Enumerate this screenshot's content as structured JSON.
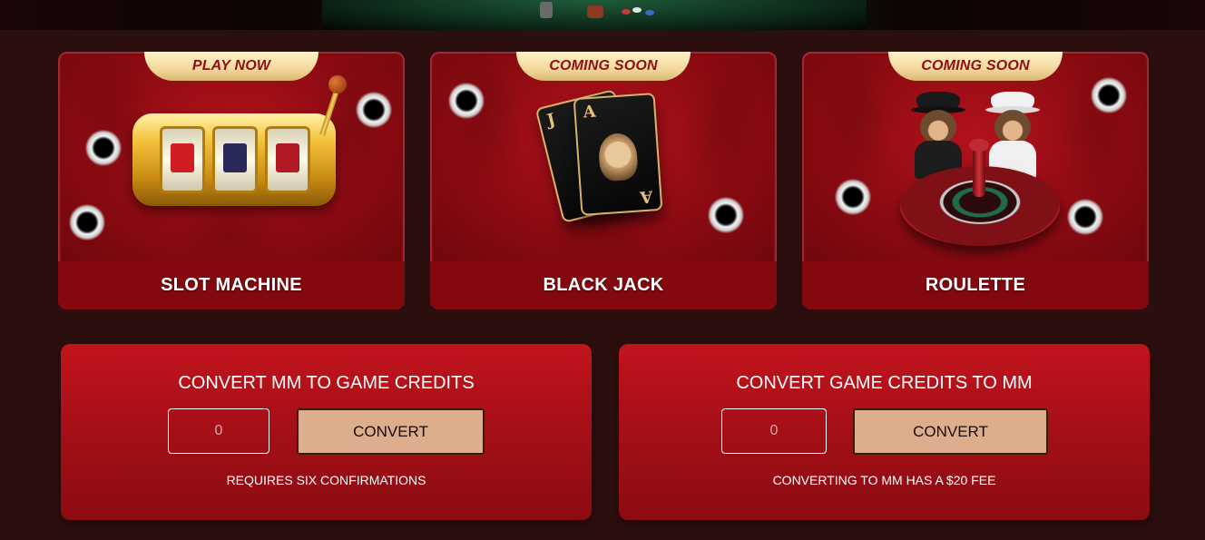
{
  "games": [
    {
      "title": "SLOT MACHINE",
      "status": "PLAY NOW"
    },
    {
      "title": "BLACK JACK",
      "status": "COMING SOON"
    },
    {
      "title": "ROULETTE",
      "status": "COMING SOON"
    }
  ],
  "convert_to_credits": {
    "title": "CONVERT MM TO GAME CREDITS",
    "amount_placeholder": "0",
    "button_label": "CONVERT",
    "note": "REQUIRES SIX CONFIRMATIONS"
  },
  "convert_to_mm": {
    "title": "CONVERT GAME CREDITS TO MM",
    "amount_placeholder": "0",
    "button_label": "CONVERT",
    "note": "CONVERTING TO MM HAS A $20 FEE"
  },
  "colors": {
    "background": "#2b0e0e",
    "card_red": "#84090f",
    "panel_red": "#c1141d",
    "badge_gold": "#f3d89b",
    "button_tan": "#dcae8c"
  }
}
